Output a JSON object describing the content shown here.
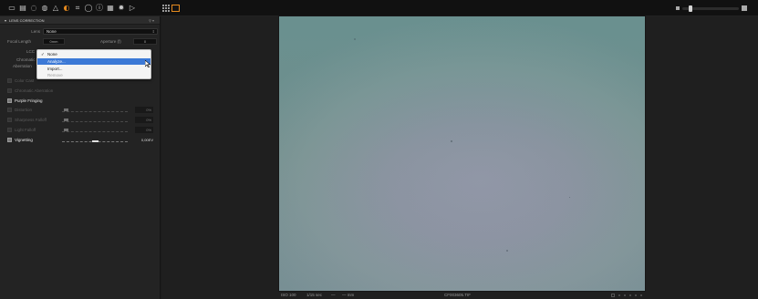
{
  "toolbar": {
    "tool_icons": [
      "folder-icon",
      "library-icon",
      "zoom-icon",
      "color-icon",
      "exposure-icon",
      "lens-icon",
      "crop-icon",
      "adjustments-icon",
      "metadata-icon",
      "output-icon",
      "settings-icon",
      "batch-icon"
    ],
    "view_icons": [
      "grid-view-icon",
      "single-view-icon"
    ],
    "accent_color": "#e58a1f",
    "zoom_percent": 12
  },
  "panel": {
    "title": "LENS CORRECTION",
    "lens_label": "Lens",
    "lens_value": "None",
    "focal_length_label": "Focal Length",
    "focal_length_value": "0mm",
    "aperture_label": "Aperture (f)",
    "aperture_value": "0",
    "lcc_label": "LCC",
    "chromatic_label_1": "Chromatic",
    "chromatic_label_2": "Aberration",
    "sections": {
      "color_cast": "Color Cast",
      "chromatic_aberration": "Chromatic Aberration",
      "purple_fringing": "Purple Fringing",
      "distortion": "Distortion",
      "sharpness_falloff": "Sharpness Falloff",
      "light_falloff": "Light Falloff",
      "vignetting": "Vignetting"
    },
    "values": {
      "distortion": "0%",
      "sharpness_falloff": "0%",
      "light_falloff": "0%",
      "vignetting": "0,00EV"
    }
  },
  "menu": {
    "items": [
      "None",
      "Analyze...",
      "Import...",
      "Remove"
    ],
    "checked": "None",
    "highlighted": "Analyze...",
    "selection_color": "#3c79d6"
  },
  "status": {
    "iso": "ISO 100",
    "shutter": "1/15 sec",
    "aperture": "—",
    "focal": "— mm",
    "filename": "CF003605.TIF"
  }
}
